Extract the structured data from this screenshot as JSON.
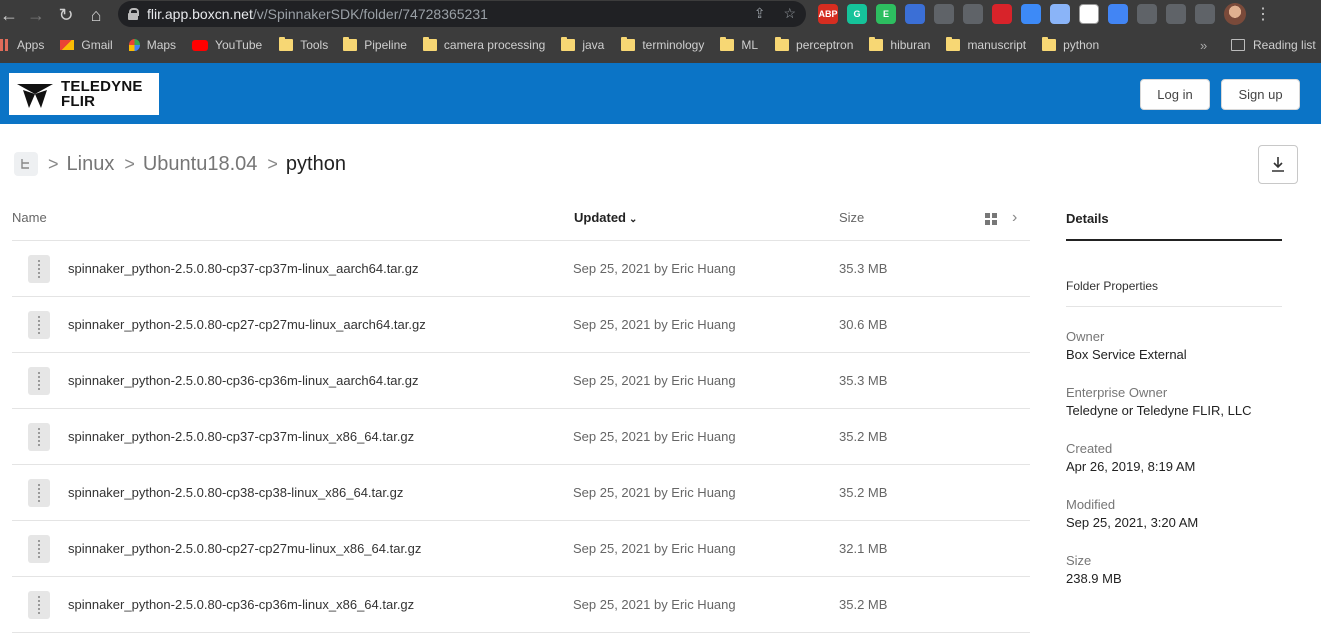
{
  "browser": {
    "url_host": "flir.app.boxcn.net",
    "url_path": "/v/SpinnakerSDK/folder/74728365231",
    "extensions": [
      {
        "name": "abp-icon",
        "label": "ABP",
        "color": "#d62d20"
      },
      {
        "name": "grammarly-icon",
        "label": "G",
        "color": "#15c39a"
      },
      {
        "name": "evernote-icon",
        "label": "E",
        "color": "#2dbe60"
      },
      {
        "name": "screen-icon",
        "label": "",
        "color": "#3b6fd6"
      },
      {
        "name": "window-icon",
        "label": "",
        "color": "#5f6368"
      },
      {
        "name": "chat-icon",
        "label": "",
        "color": "#5f6368"
      },
      {
        "name": "mendeley-icon",
        "label": "",
        "color": "#d8232a"
      },
      {
        "name": "dropbox-icon",
        "label": "",
        "color": "#3d8af7"
      },
      {
        "name": "pen-icon",
        "label": "",
        "color": "#8ab4f8"
      },
      {
        "name": "doc-icon",
        "label": "",
        "color": "#ffffff"
      },
      {
        "name": "feather-icon",
        "label": "",
        "color": "#4285f4"
      },
      {
        "name": "chart-icon",
        "label": "",
        "color": "#5f6368"
      },
      {
        "name": "vpn-icon",
        "label": "",
        "color": "#5f6368"
      },
      {
        "name": "puzzle-icon",
        "label": "",
        "color": "#5f6368"
      }
    ],
    "bookmarks": [
      {
        "label": "Apps",
        "icon": "apps-grid-icon"
      },
      {
        "label": "Gmail",
        "icon": "gmail-icon"
      },
      {
        "label": "Maps",
        "icon": "maps-icon"
      },
      {
        "label": "YouTube",
        "icon": "youtube-icon"
      },
      {
        "label": "Tools",
        "icon": "folder-icon"
      },
      {
        "label": "Pipeline",
        "icon": "folder-icon"
      },
      {
        "label": "camera processing",
        "icon": "folder-icon"
      },
      {
        "label": "java",
        "icon": "folder-icon"
      },
      {
        "label": "terminology",
        "icon": "folder-icon"
      },
      {
        "label": "ML",
        "icon": "folder-icon"
      },
      {
        "label": "perceptron",
        "icon": "folder-icon"
      },
      {
        "label": "hiburan",
        "icon": "folder-icon"
      },
      {
        "label": "manuscript",
        "icon": "folder-icon"
      },
      {
        "label": "python",
        "icon": "folder-icon"
      }
    ],
    "bookmarks_more": "»",
    "reading_list": "Reading list"
  },
  "header": {
    "logo_line1": "TELEDYNE",
    "logo_line2": "FLIR",
    "login": "Log in",
    "signup": "Sign up",
    "brand_color": "#0b74c6"
  },
  "breadcrumb": {
    "items": [
      "Linux",
      "Ubuntu18.04"
    ],
    "current": "python",
    "separator": ">"
  },
  "table": {
    "col_name": "Name",
    "col_updated": "Updated",
    "col_size": "Size",
    "rows": [
      {
        "name": "spinnaker_python-2.5.0.80-cp37-cp37m-linux_aarch64.tar.gz",
        "updated": "Sep 25, 2021 by Eric Huang",
        "size": "35.3 MB"
      },
      {
        "name": "spinnaker_python-2.5.0.80-cp27-cp27mu-linux_aarch64.tar.gz",
        "updated": "Sep 25, 2021 by Eric Huang",
        "size": "30.6 MB"
      },
      {
        "name": "spinnaker_python-2.5.0.80-cp36-cp36m-linux_aarch64.tar.gz",
        "updated": "Sep 25, 2021 by Eric Huang",
        "size": "35.3 MB"
      },
      {
        "name": "spinnaker_python-2.5.0.80-cp37-cp37m-linux_x86_64.tar.gz",
        "updated": "Sep 25, 2021 by Eric Huang",
        "size": "35.2 MB"
      },
      {
        "name": "spinnaker_python-2.5.0.80-cp38-cp38-linux_x86_64.tar.gz",
        "updated": "Sep 25, 2021 by Eric Huang",
        "size": "35.2 MB"
      },
      {
        "name": "spinnaker_python-2.5.0.80-cp27-cp27mu-linux_x86_64.tar.gz",
        "updated": "Sep 25, 2021 by Eric Huang",
        "size": "32.1 MB"
      },
      {
        "name": "spinnaker_python-2.5.0.80-cp36-cp36m-linux_x86_64.tar.gz",
        "updated": "Sep 25, 2021 by Eric Huang",
        "size": "35.2 MB"
      }
    ]
  },
  "details": {
    "tab": "Details",
    "section": "Folder Properties",
    "props": [
      {
        "label": "Owner",
        "value": "Box Service External"
      },
      {
        "label": "Enterprise Owner",
        "value": "Teledyne or Teledyne FLIR, LLC"
      },
      {
        "label": "Created",
        "value": "Apr 26, 2019, 8:19 AM"
      },
      {
        "label": "Modified",
        "value": "Sep 25, 2021, 3:20 AM"
      },
      {
        "label": "Size",
        "value": "238.9 MB"
      }
    ]
  }
}
